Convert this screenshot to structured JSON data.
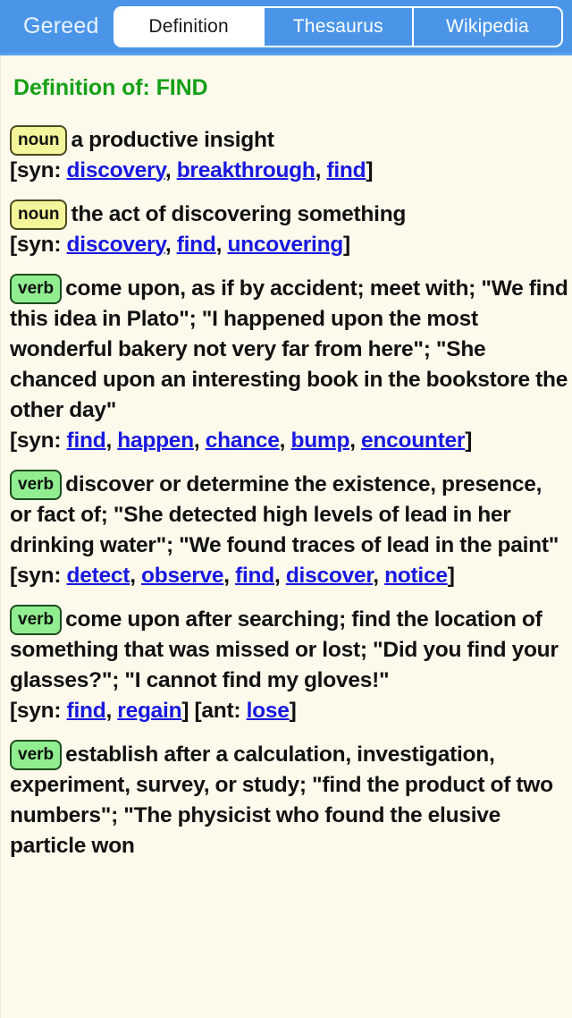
{
  "header": {
    "app_title": "Gereed",
    "tabs": [
      {
        "label": "Definition",
        "active": true
      },
      {
        "label": "Thesaurus",
        "active": false
      },
      {
        "label": "Wikipedia",
        "active": false
      }
    ]
  },
  "colors": {
    "header_bg": "#4a95e8",
    "page_bg": "#fdfaec",
    "title_green": "#16a016",
    "link_blue": "#1818e0",
    "noun_badge_bg": "#f4f49a",
    "verb_badge_bg": "#90ee90",
    "body_text": "#111111"
  },
  "main": {
    "page_title": "Definition of: FIND",
    "labels": {
      "syn_open": "[syn: ",
      "ant_open": "[ant: ",
      "close": "]",
      "separator": ", ",
      "space": " "
    },
    "entries": [
      {
        "pos": "noun",
        "pos_class": "noun",
        "gloss": "a productive insight",
        "syn": [
          "discovery",
          "breakthrough",
          "find"
        ],
        "ant": []
      },
      {
        "pos": "noun",
        "pos_class": "noun",
        "gloss": "the act of discovering something",
        "syn": [
          "discovery",
          "find",
          "uncovering"
        ],
        "ant": []
      },
      {
        "pos": "verb",
        "pos_class": "verb",
        "gloss": "come upon, as if by accident; meet with; \"We find this idea in Plato\"; \"I happened upon the most wonderful bakery not very far from here\"; \"She chanced upon an interesting book in the bookstore the other day\"",
        "syn": [
          "find",
          "happen",
          "chance",
          "bump",
          "encounter"
        ],
        "ant": []
      },
      {
        "pos": "verb",
        "pos_class": "verb",
        "gloss": "discover or determine the existence, presence, or fact of; \"She detected high levels of lead in her drinking water\"; \"We found traces of lead in the paint\"",
        "syn": [
          "detect",
          "observe",
          "find",
          "discover",
          "notice"
        ],
        "ant": []
      },
      {
        "pos": "verb",
        "pos_class": "verb",
        "gloss": "come upon after searching; find the location of something that was missed or lost; \"Did you find your glasses?\"; \"I cannot find my gloves!\"",
        "syn": [
          "find",
          "regain"
        ],
        "ant": [
          "lose"
        ]
      },
      {
        "pos": "verb",
        "pos_class": "verb",
        "gloss": "establish after a calculation, investigation, experiment, survey, or study; \"find the product of two numbers\"; \"The physicist who found the elusive particle won",
        "syn": [],
        "ant": []
      }
    ]
  }
}
